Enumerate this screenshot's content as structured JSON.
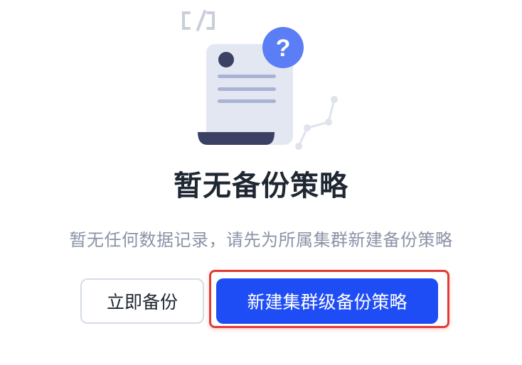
{
  "empty_state": {
    "title": "暂无备份策略",
    "description": "暂无任何数据记录，请先为所属集群新建备份策略",
    "illustration_icons": [
      "document-icon",
      "question-mark-icon",
      "code-bracket-icon",
      "line-chart-icon"
    ],
    "question_mark": "?"
  },
  "actions": {
    "backup_now_label": "立即备份",
    "create_cluster_policy_label": "新建集群级备份策略"
  },
  "colors": {
    "primary": "#1f4df5",
    "highlight": "#e23b35",
    "title_text": "#1f2733",
    "muted_text": "#8a93a6"
  }
}
